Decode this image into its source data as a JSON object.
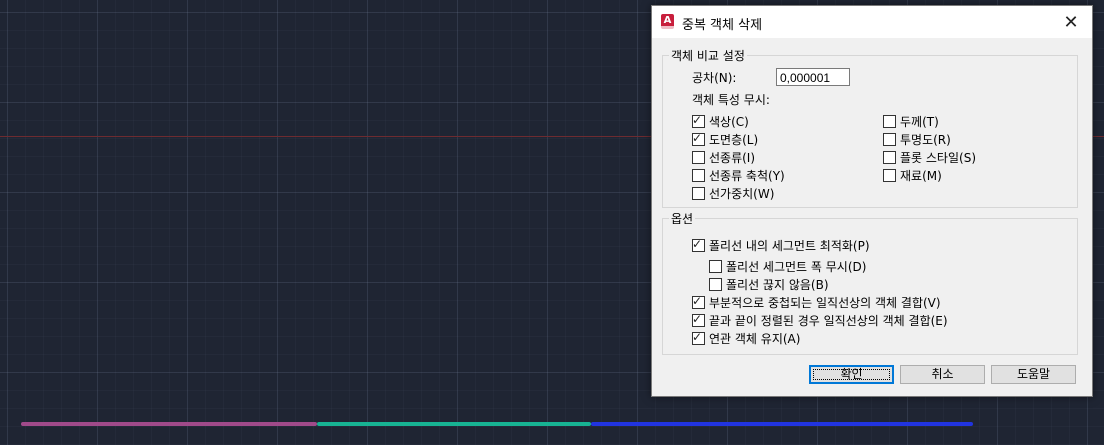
{
  "dialog": {
    "title": "중복 객체 삭제",
    "app_icon_letter": "A",
    "close_glyph": "✕",
    "groups": {
      "compare": {
        "label": "객체 비교 설정",
        "tolerance_label": "공차(N):",
        "tolerance_value": "0,000001",
        "ignore_label": "객체 특성 무시:",
        "left_items": [
          {
            "label": "색상(C)",
            "checked": true
          },
          {
            "label": "도면층(L)",
            "checked": true
          },
          {
            "label": "선종류(I)",
            "checked": false
          },
          {
            "label": "선종류 축척(Y)",
            "checked": false
          },
          {
            "label": "선가중치(W)",
            "checked": false
          }
        ],
        "right_items": [
          {
            "label": "두께(T)",
            "checked": false
          },
          {
            "label": "투명도(R)",
            "checked": false
          },
          {
            "label": "플롯 스타일(S)",
            "checked": false
          },
          {
            "label": "재료(M)",
            "checked": false
          }
        ]
      },
      "options": {
        "label": "옵션",
        "items": [
          {
            "label": "폴리선 내의 세그먼트 최적화(P)",
            "checked": true
          },
          {
            "label": "폴리선 세그먼트 폭 무시(D)",
            "checked": false
          },
          {
            "label": "폴리선 끊지 않음(B)",
            "checked": false
          },
          {
            "label": "부분적으로 중첩되는 일직선상의 객체 결합(V)",
            "checked": true
          },
          {
            "label": "끝과 끝이 정렬된 경우 일직선상의 객체 결합(E)",
            "checked": true
          },
          {
            "label": "연관 객체 유지(A)",
            "checked": true
          }
        ]
      }
    },
    "buttons": {
      "ok": "확인",
      "cancel": "취소",
      "help": "도움말"
    }
  },
  "colors": {
    "canvas_bg": "#1f2533",
    "segment_1": "#a04a8a",
    "segment_2": "#17b393",
    "segment_3": "#2134e0",
    "axis": "#6e2b30"
  }
}
